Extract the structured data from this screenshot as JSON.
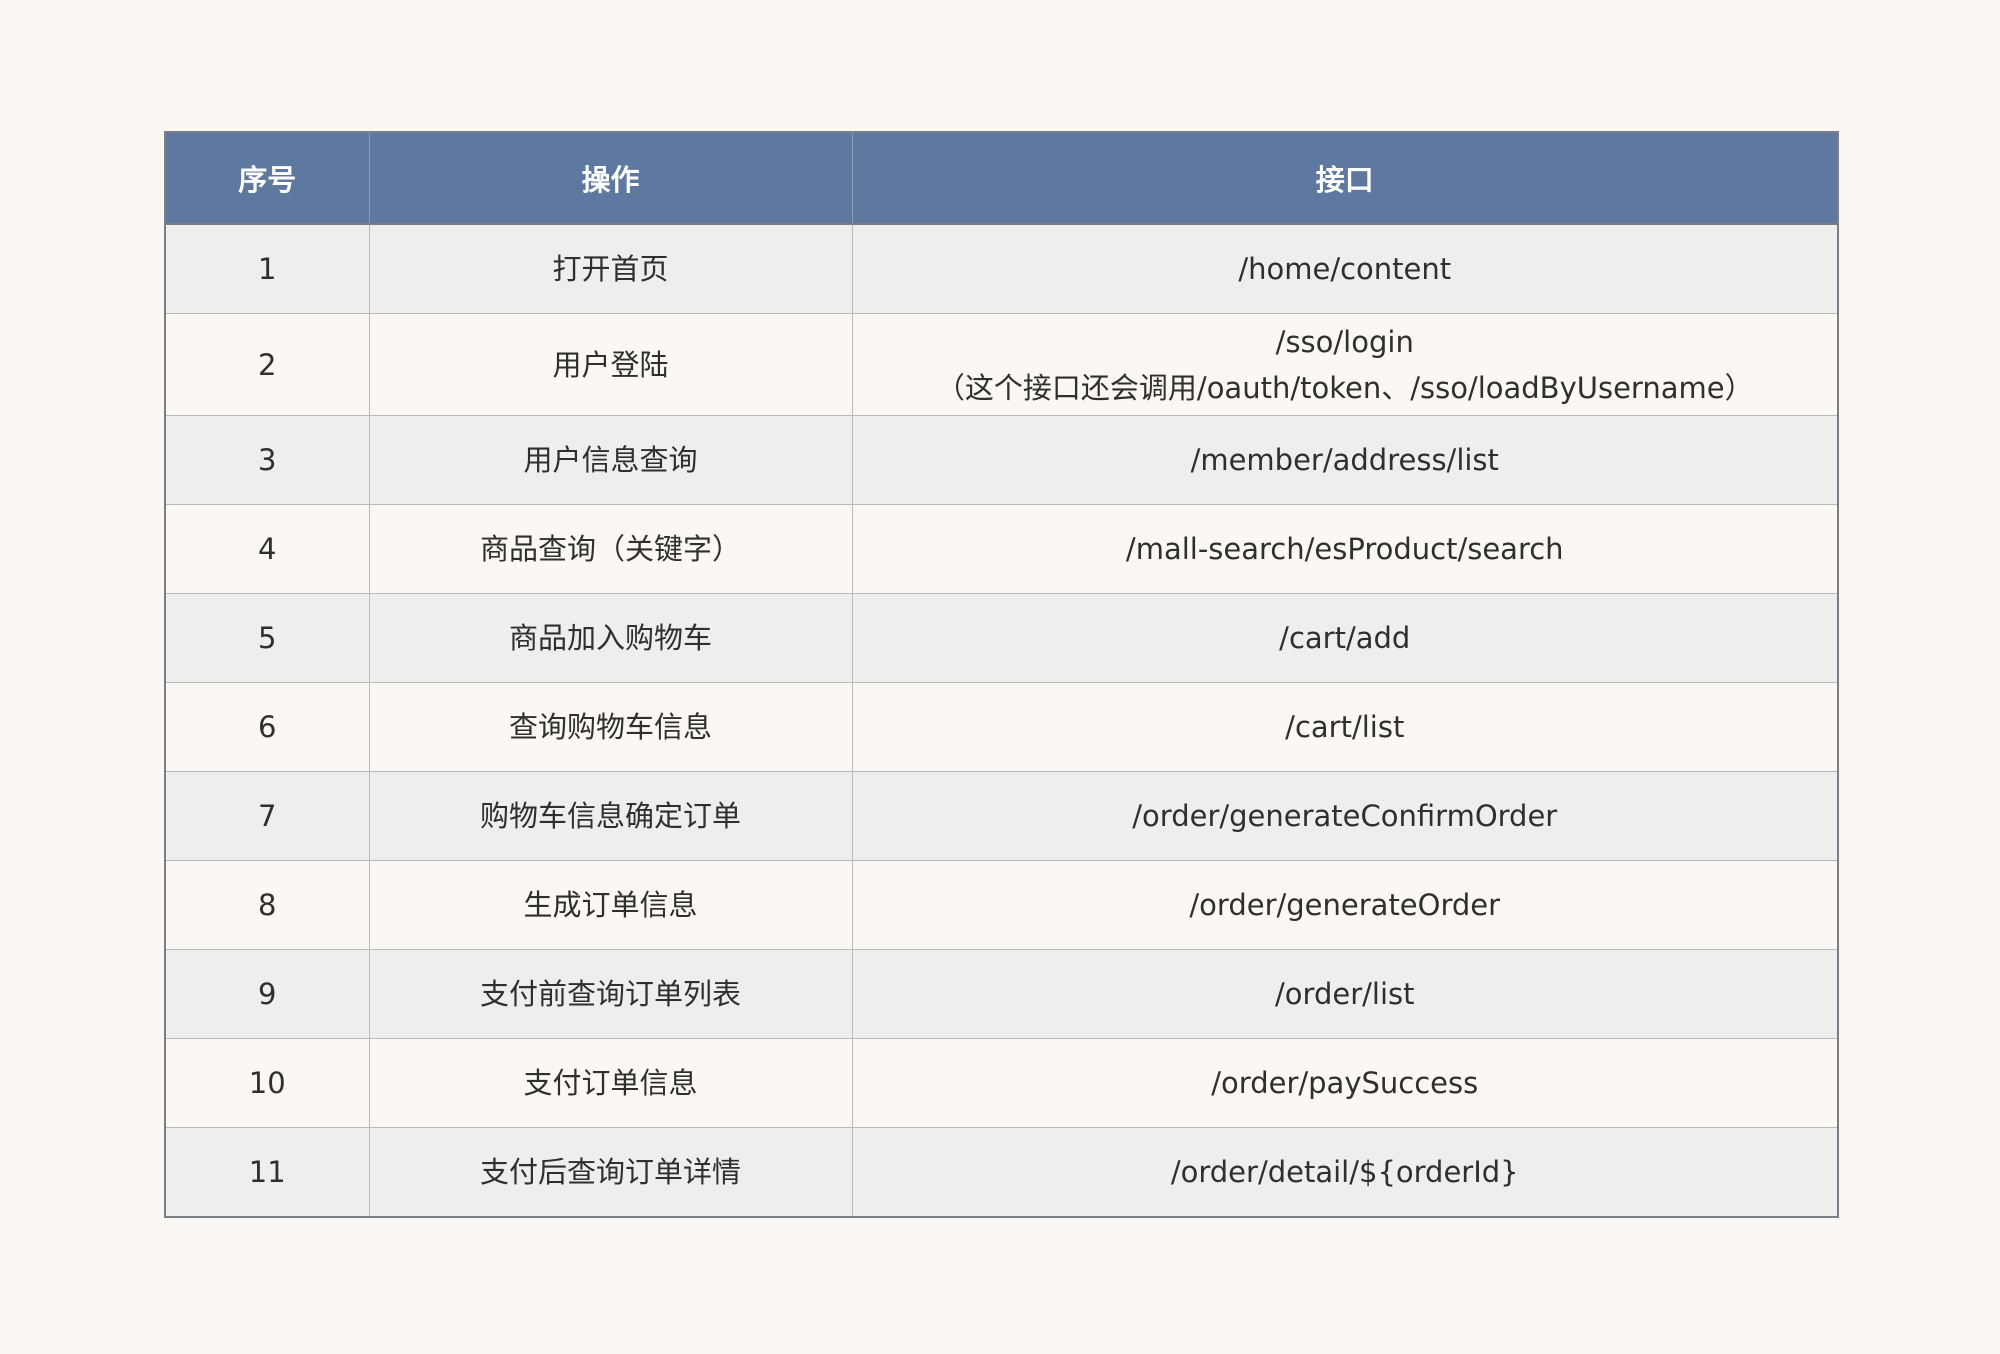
{
  "table": {
    "headers": [
      "序号",
      "操作",
      "接口"
    ],
    "rows": [
      {
        "no": "1",
        "action": "打开首页",
        "api": "/home/content",
        "api_note": ""
      },
      {
        "no": "2",
        "action": "用户登陆",
        "api": "/sso/login",
        "api_note": "（这个接口还会调用/oauth/token、/sso/loadByUsername）"
      },
      {
        "no": "3",
        "action": "用户信息查询",
        "api": "/member/address/list",
        "api_note": ""
      },
      {
        "no": "4",
        "action": "商品查询（关键字）",
        "api": "/mall-search/esProduct/search",
        "api_note": ""
      },
      {
        "no": "5",
        "action": "商品加入购物车",
        "api": "/cart/add",
        "api_note": ""
      },
      {
        "no": "6",
        "action": "查询购物车信息",
        "api": "/cart/list",
        "api_note": ""
      },
      {
        "no": "7",
        "action": "购物车信息确定订单",
        "api": "/order/generateConfirmOrder",
        "api_note": ""
      },
      {
        "no": "8",
        "action": "生成订单信息",
        "api": "/order/generateOrder",
        "api_note": ""
      },
      {
        "no": "9",
        "action": "支付前查询订单列表",
        "api": "/order/list",
        "api_note": ""
      },
      {
        "no": "10",
        "action": "支付订单信息",
        "api": "/order/paySuccess",
        "api_note": ""
      },
      {
        "no": "11",
        "action": "支付后查询订单详情",
        "api": "/order/detail/${orderId}",
        "api_note": ""
      }
    ]
  },
  "colors": {
    "header_bg": "#5e78a0",
    "page_bg": "#fbf8f3",
    "row_alt_bg": "#eeeeee"
  }
}
